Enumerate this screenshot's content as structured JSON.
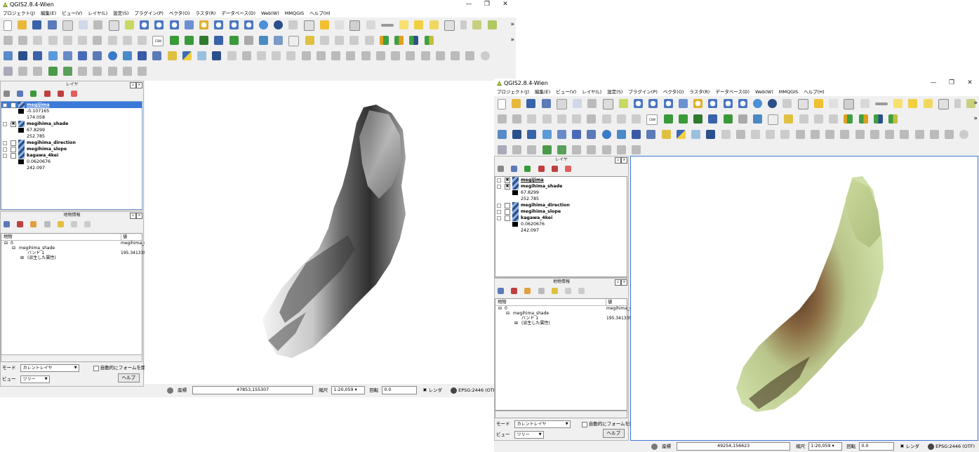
{
  "app_title": "QGIS2.8.4-Wien",
  "menu": [
    "プロジェクト(J)",
    "編集(E)",
    "ビュー(V)",
    "レイヤ(L)",
    "設定(S)",
    "プラグイン(P)",
    "ベクタ(O)",
    "ラスタ(R)",
    "データベース(D)",
    "Web(W)",
    "MMQGIS",
    "ヘルプ(H)"
  ],
  "toolbar_overflow": "»",
  "csw_label": "CSW",
  "window_controls": {
    "minimize": "—",
    "restore": "❐",
    "close": "✕"
  },
  "layers_panel": {
    "title": "レイヤ",
    "layers": [
      {
        "name": "megijima",
        "checked": false,
        "selected": true,
        "legend": [
          "-0.107165",
          "174.058"
        ]
      },
      {
        "name": "megihima_shade",
        "checked": true,
        "selected": false,
        "legend": [
          "67.8299",
          "252.785"
        ]
      },
      {
        "name": "megihima_direction",
        "checked": false,
        "selected": false,
        "legend": []
      },
      {
        "name": "megihima_slope",
        "checked": false,
        "selected": false,
        "legend": []
      },
      {
        "name": "kagawa_4kei",
        "checked": false,
        "selected": false,
        "legend": [
          "0.0620676",
          "242.097"
        ]
      }
    ]
  },
  "identify_panel": {
    "title": "地物情報",
    "col_feature": "地物",
    "col_value": "値",
    "root": "0",
    "root_value": "megihima_s",
    "layer": "megihima_shade",
    "band_label": "バンド 1",
    "band_value": "195.341339",
    "derived": "(派生した属性)",
    "mode_label": "モード",
    "mode_value": "カレントレイヤ",
    "auto_form_label": "自動的にフォームを開く",
    "view_label": "ビュー",
    "view_value": "ツリー",
    "help_button": "ヘルプ"
  },
  "window1": {
    "coord_label": "座標",
    "coord_value": "47853,155307",
    "scale_label": "縮尺",
    "scale_value": "1:20,059",
    "rotation_label": "回転",
    "rotation_value": "0.0",
    "render_label": "レンダ",
    "crs": "EPSG:2446 (OTF)"
  },
  "window2": {
    "coord_label": "座標",
    "coord_value": "49254,156623",
    "scale_label": "縮尺",
    "scale_value": "1:20,059",
    "rotation_label": "回転",
    "rotation_value": "0.0",
    "render_label": "レンダ",
    "crs": "EPSG:2446 (OTF)"
  },
  "colors": {
    "selection": "#3b79d8",
    "accent": "#2a4f8a"
  },
  "icons": [
    "new-file-icon",
    "open-icon",
    "save-icon",
    "pan-icon",
    "zoom-in-icon",
    "zoom-out-icon",
    "identify-icon",
    "python-icon",
    "help-icon",
    "filter-icon",
    "crs-icon"
  ]
}
